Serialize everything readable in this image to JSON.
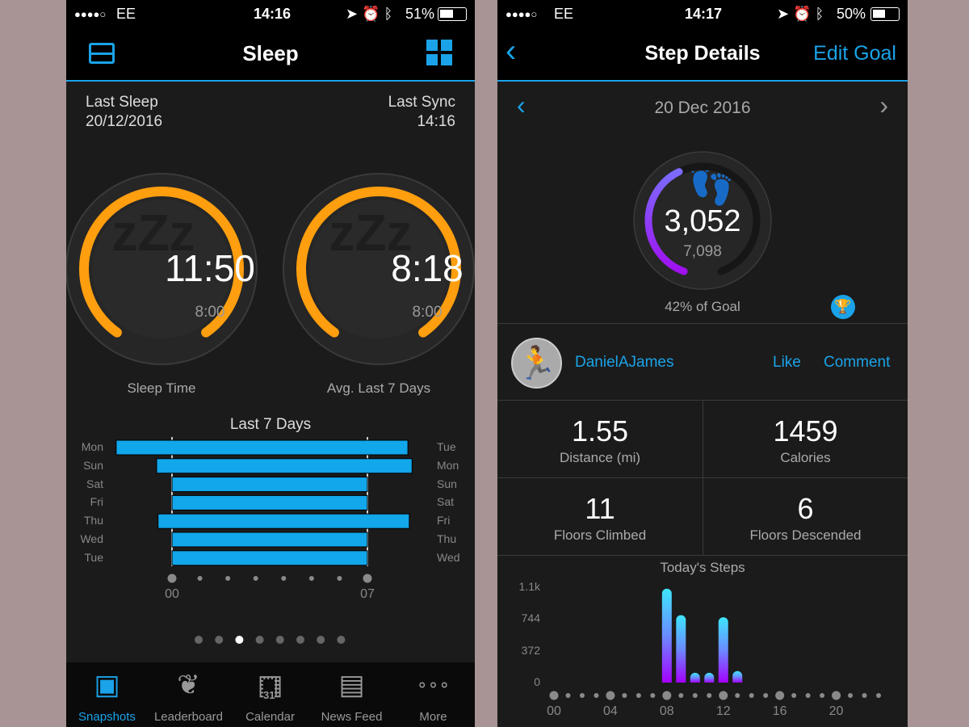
{
  "left": {
    "status": {
      "signal": "●●●●○",
      "carrier": "EE",
      "time": "14:16",
      "battery": "51%"
    },
    "header": {
      "title": "Sleep",
      "left_icon": "inbox-icon",
      "right_icon": "grid-icon"
    },
    "last_sleep": {
      "label": "Last Sleep",
      "value": "20/12/2016"
    },
    "last_sync": {
      "label": "Last Sync",
      "value": "14:16"
    },
    "rings": [
      {
        "value": "11:50",
        "goal": "8:00",
        "label": "Sleep Time"
      },
      {
        "value": "8:18",
        "goal": "8:00",
        "label": "Avg. Last 7 Days"
      }
    ],
    "accent": "#ff9e0f",
    "page_dots": {
      "count": 8,
      "active": 2
    },
    "tabs": [
      {
        "label": "Snapshots",
        "icon": "snapshots-icon",
        "active": true
      },
      {
        "label": "Leaderboard",
        "icon": "laurel-icon"
      },
      {
        "label": "Calendar",
        "icon": "calendar-icon",
        "badge": "31"
      },
      {
        "label": "News Feed",
        "icon": "newspaper-icon"
      },
      {
        "label": "More",
        "icon": "more-icon"
      }
    ]
  },
  "right": {
    "status": {
      "signal": "●●●●○",
      "carrier": "EE",
      "time": "14:17",
      "battery": "50%"
    },
    "header": {
      "title": "Step Details",
      "edit_goal": "Edit Goal"
    },
    "date": "20 Dec 2016",
    "steps": {
      "value": "3,052",
      "goal": "7,098",
      "percent_text": "42% of Goal",
      "progress": 0.42
    },
    "user": {
      "name": "DanielAJames",
      "like": "Like",
      "comment": "Comment"
    },
    "stats": [
      {
        "value": "1.55",
        "label": "Distance (mi)"
      },
      {
        "value": "1459",
        "label": "Calories"
      },
      {
        "value": "11",
        "label": "Floors Climbed"
      },
      {
        "value": "6",
        "label": "Floors Descended"
      }
    ]
  },
  "chart_data": [
    {
      "type": "bar",
      "title": "Last 7 Days",
      "orientation": "horizontal",
      "left_labels": [
        "Mon",
        "Sun",
        "Sat",
        "Fri",
        "Thu",
        "Wed",
        "Tue"
      ],
      "right_labels": [
        "Tue",
        "Mon",
        "Sun",
        "Sat",
        "Fri",
        "Thu",
        "Wed"
      ],
      "series": [
        {
          "start": [
            -2.0,
            -0.55,
            0,
            0,
            -0.5,
            0,
            0
          ],
          "end": [
            8.45,
            8.6,
            7,
            7,
            8.5,
            7,
            7
          ]
        }
      ],
      "x_ticks": [
        "00",
        "07"
      ],
      "xlim": [
        0,
        7
      ],
      "color": "#12a6ea"
    },
    {
      "type": "bar",
      "title": "Today's Steps",
      "x": [
        8,
        9,
        10,
        11,
        12,
        13
      ],
      "values": [
        1100,
        790,
        115,
        115,
        765,
        135
      ],
      "y_ticks": [
        "1.1k",
        "744",
        "372",
        "0"
      ],
      "ylim": [
        0,
        1116
      ],
      "x_ticks": [
        "00",
        "04",
        "08",
        "12",
        "16",
        "20"
      ],
      "xlim": [
        0,
        23
      ]
    }
  ]
}
